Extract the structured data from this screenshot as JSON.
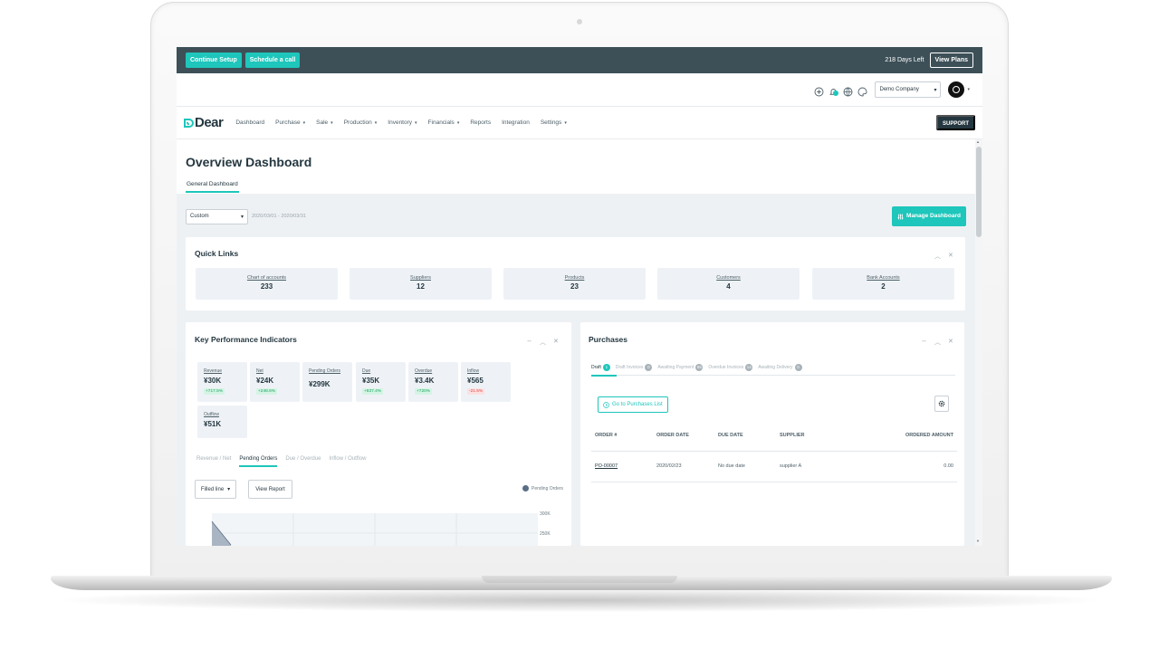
{
  "setup_bar": {
    "continue_label": "Continue Setup",
    "schedule_label": "Schedule a call",
    "days_left": "218 Days Left",
    "view_plans_label": "View Plans"
  },
  "top_util": {
    "company": "Demo Company"
  },
  "nav": {
    "logo": "Dear",
    "items": [
      "Dashboard",
      "Purchase",
      "Sale",
      "Production",
      "Inventory",
      "Financials",
      "Reports",
      "Integration",
      "Settings"
    ],
    "support_label": "SUPPORT"
  },
  "page": {
    "title": "Overview Dashboard",
    "tab": "General Dashboard"
  },
  "filters": {
    "range": "Custom",
    "dates": "2020/03/01 - 2020/03/31",
    "manage_label": "Manage Dashboard"
  },
  "quick_links": {
    "title": "Quick Links",
    "items": [
      {
        "label": "Chart of accounts",
        "count": "233"
      },
      {
        "label": "Suppliers",
        "count": "12"
      },
      {
        "label": "Products",
        "count": "23"
      },
      {
        "label": "Customers",
        "count": "4"
      },
      {
        "label": "Bank Accounts",
        "count": "2"
      }
    ]
  },
  "kpi": {
    "title": "Key Performance Indicators",
    "tiles": [
      {
        "label": "Revenue",
        "value": "¥30K",
        "delta": "+717.5%",
        "trend": "up"
      },
      {
        "label": "Net",
        "value": "¥24K",
        "delta": "+248.6%",
        "trend": "up"
      },
      {
        "label": "Pending Orders",
        "value": "¥299K",
        "delta": "",
        "trend": ""
      },
      {
        "label": "Due",
        "value": "¥35K",
        "delta": "+837.4%",
        "trend": "up"
      },
      {
        "label": "Overdue",
        "value": "¥3.4K",
        "delta": "+720%",
        "trend": "up"
      },
      {
        "label": "Inflow",
        "value": "¥565",
        "delta": "-21.5%",
        "trend": "down"
      },
      {
        "label": "Outflow",
        "value": "¥51K",
        "delta": "",
        "trend": ""
      }
    ],
    "chart_tabs": [
      "Revenue / Net",
      "Pending Orders",
      "Due / Overdue",
      "Inflow / Outflow"
    ],
    "chart_type": "Filled line",
    "view_report_label": "View Report"
  },
  "chart_data": {
    "type": "area",
    "legend": [
      "Pending Orders"
    ],
    "legend_position": "top-right",
    "y_ticks": [
      "300K",
      "250K"
    ],
    "series": [
      {
        "name": "Pending Orders",
        "color": "#5a6e85"
      }
    ],
    "grid": true
  },
  "purchases": {
    "title": "Purchases",
    "tabs": [
      {
        "label": "Draft",
        "count": "1"
      },
      {
        "label": "Draft Invoices",
        "count": "0"
      },
      {
        "label": "Awaiting Payment",
        "count": "65"
      },
      {
        "label": "Overdue Invoices",
        "count": "14"
      },
      {
        "label": "Awaiting Delivery",
        "count": "0"
      }
    ],
    "go_label": "Go to Purchases List",
    "columns": [
      "ORDER #",
      "ORDER DATE",
      "DUE DATE",
      "SUPPLIER",
      "ORDERED AMOUNT"
    ],
    "rows": [
      {
        "order": "PO-00007",
        "order_date": "2020/02/23",
        "due_date": "No due date",
        "supplier": "supplier A",
        "amount": "0.00"
      }
    ]
  }
}
